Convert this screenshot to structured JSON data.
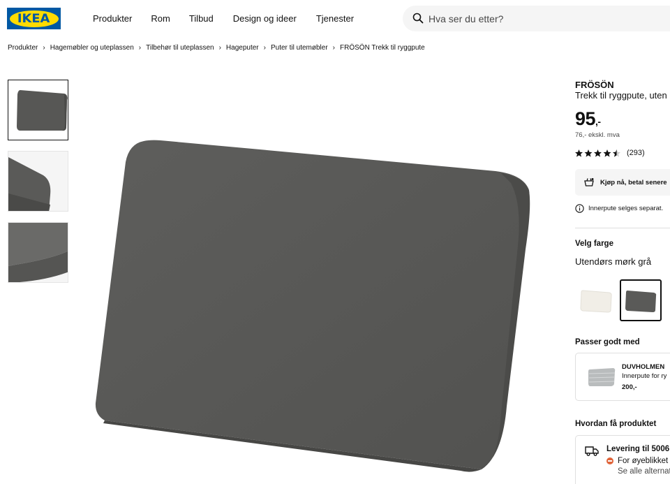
{
  "header": {
    "logo_text": "IKEA",
    "nav": [
      "Produkter",
      "Rom",
      "Tilbud",
      "Design og ideer",
      "Tjenester"
    ],
    "search_placeholder": "Hva ser du etter?"
  },
  "breadcrumb": [
    "Produkter",
    "Hagemøbler og uteplassen",
    "Tilbehør til uteplassen",
    "Hageputer",
    "Puter til utemøbler",
    "FRÖSÖN Trekk til ryggpute"
  ],
  "product": {
    "brand": "FRÖSÖN",
    "subtitle": "Trekk til ryggpute, uten",
    "price": "95",
    "price_suffix": ",-",
    "price_ex_vat": "76,- ekskl. mva",
    "rating_stars": 4.5,
    "rating_count": "(293)",
    "pay_later": "Kjøp nå, betal senere",
    "info_note": "Innerpute selges separat.",
    "color_heading": "Velg farge",
    "color_selected": "Utendørs mørk grå",
    "colors": [
      "#f1eee7",
      "#5a5a58"
    ],
    "accent_color": "#0058a3",
    "logo_yellow": "#ffdb00"
  },
  "matches": {
    "heading": "Passer godt med",
    "name": "DUVHOLMEN",
    "desc": "Innerpute for ry",
    "price": "200,-"
  },
  "delivery": {
    "heading": "Hvordan få produktet",
    "title": "Levering til 5006",
    "status": "For øyeblikket",
    "alt": "Se alle alternat"
  },
  "icons": [
    "search-icon",
    "chevron-right-icon",
    "star-icon",
    "pay-later-icon",
    "info-icon",
    "truck-icon",
    "status-dot-icon"
  ]
}
